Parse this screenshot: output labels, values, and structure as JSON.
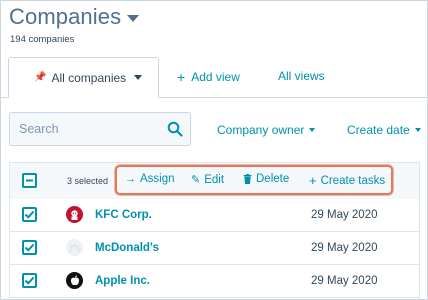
{
  "header": {
    "title": "Companies",
    "count_text": "194 companies"
  },
  "tabs": {
    "active": "All companies",
    "add_view": "Add view",
    "all_views": "All views"
  },
  "filters": {
    "search_placeholder": "Search",
    "company_owner": "Company owner",
    "create_date": "Create date"
  },
  "bulk_actions": {
    "selected_text": "3 selected",
    "assign": "Assign",
    "edit": "Edit",
    "delete": "Delete",
    "create_tasks": "Create tasks",
    "highlight_color": "#e07a5f"
  },
  "rows": [
    {
      "name": "KFC Corp.",
      "date": "29 May 2020",
      "logo": "kfc-logo",
      "checked": true
    },
    {
      "name": "McDonald's",
      "date": "29 May 2020",
      "logo": "mcdonalds-logo",
      "checked": true
    },
    {
      "name": "Apple Inc.",
      "date": "29 May 2020",
      "logo": "apple-logo",
      "checked": true
    }
  ],
  "colors": {
    "accent": "#0091ae",
    "text": "#33475b",
    "title": "#516f90",
    "border": "#cbd6e2"
  }
}
